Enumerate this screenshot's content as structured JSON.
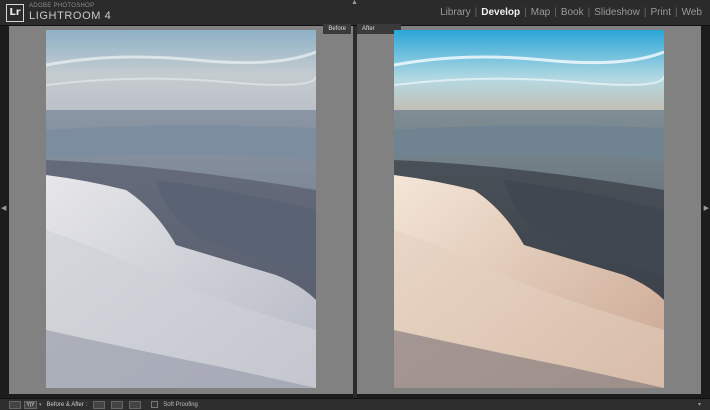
{
  "app": {
    "brand_small": "ADOBE PHOTOSHOP",
    "brand_big": "LIGHTROOM 4",
    "badge": "Lr"
  },
  "modules": [
    {
      "label": "Library",
      "active": false
    },
    {
      "label": "Develop",
      "active": true
    },
    {
      "label": "Map",
      "active": false
    },
    {
      "label": "Book",
      "active": false
    },
    {
      "label": "Slideshow",
      "active": false
    },
    {
      "label": "Print",
      "active": false
    },
    {
      "label": "Web",
      "active": false
    }
  ],
  "panes": {
    "before_label": "Before",
    "after_label": "After"
  },
  "toolbar": {
    "view_mode_icon": "Y|Y",
    "view_mode_label": "Before & After :",
    "soft_proofing_label": "Soft Proofing"
  },
  "colors": {
    "active_module": "#f0f0f0",
    "inactive_module": "#9a9a9a",
    "canvas_background": "#818181"
  }
}
